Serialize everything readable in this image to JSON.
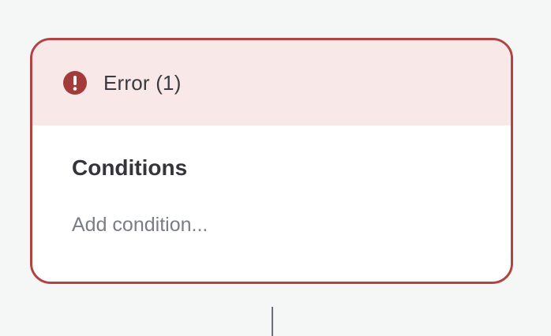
{
  "node": {
    "error_label": "Error (1)",
    "error_icon": "exclamation-circle-icon",
    "section_title": "Conditions",
    "add_condition_placeholder": "Add condition..."
  },
  "colors": {
    "error_border": "#b14441",
    "error_header_bg": "#f8e8e7",
    "error_icon": "#a33b3a",
    "canvas_bg": "#f5f6f6"
  }
}
